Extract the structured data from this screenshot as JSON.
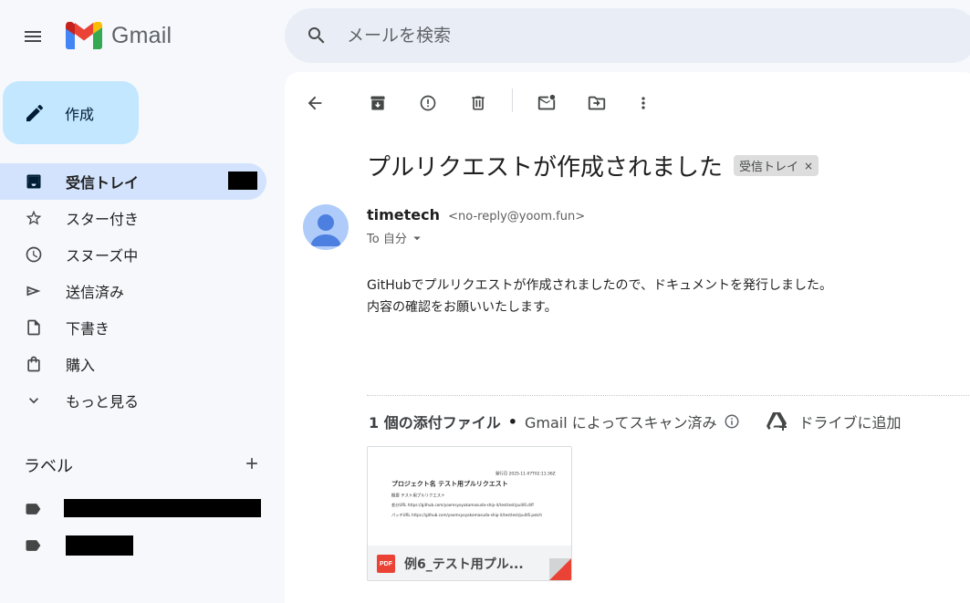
{
  "app": {
    "logo_text": "Gmail"
  },
  "search": {
    "placeholder": "メールを検索"
  },
  "compose": {
    "label": "作成"
  },
  "nav": {
    "items": [
      {
        "label": "受信トレイ",
        "icon": "inbox-icon"
      },
      {
        "label": "スター付き",
        "icon": "star-icon"
      },
      {
        "label": "スヌーズ中",
        "icon": "clock-icon"
      },
      {
        "label": "送信済み",
        "icon": "send-icon"
      },
      {
        "label": "下書き",
        "icon": "draft-icon"
      },
      {
        "label": "購入",
        "icon": "shopping-bag-icon"
      },
      {
        "label": "もっと見る",
        "icon": "chevron-down-icon"
      }
    ]
  },
  "labels": {
    "title": "ラベル",
    "add_icon": "plus-icon"
  },
  "message": {
    "subject": "プルリクエストが作成されました",
    "chip": "受信トレイ",
    "chip_close": "×",
    "sender_name": "timetech",
    "sender_email": "<no-reply@yoom.fun>",
    "to": "To 自分",
    "body_lines": [
      "GitHubでプルリクエストが作成されましたので、ドキュメントを発行しました。",
      "内容の確認をお願いいたします。"
    ]
  },
  "attachments": {
    "count_label": "1 個の添付ファイル",
    "separator": "•",
    "scan_label": "Gmail によってスキャン済み",
    "drive_label": "ドライブに追加",
    "file": {
      "name": "例6_テスト用プル...",
      "type_badge": "PDF",
      "preview": {
        "date": "発行日 2025-11-07T02:11:36Z",
        "title": "プロジェクト名 テスト用プルリクエスト",
        "summary": "概要 テスト用プルリクエスト",
        "diff_url": "差分URL https://github.com/yoomsyoyakamasuda-ship-it/testtest/pull/6.diff",
        "patch_url": "パッチURL https://github.com/yoomsyoyakamasuda-ship-it/testtest/pull/6.patch"
      }
    }
  },
  "colors": {
    "compose_bg": "#c2e7ff",
    "active_nav_bg": "#d3e3fd",
    "search_bg": "#e9eef6",
    "page_bg": "#f6f8fc",
    "pdf_red": "#ea4335"
  }
}
